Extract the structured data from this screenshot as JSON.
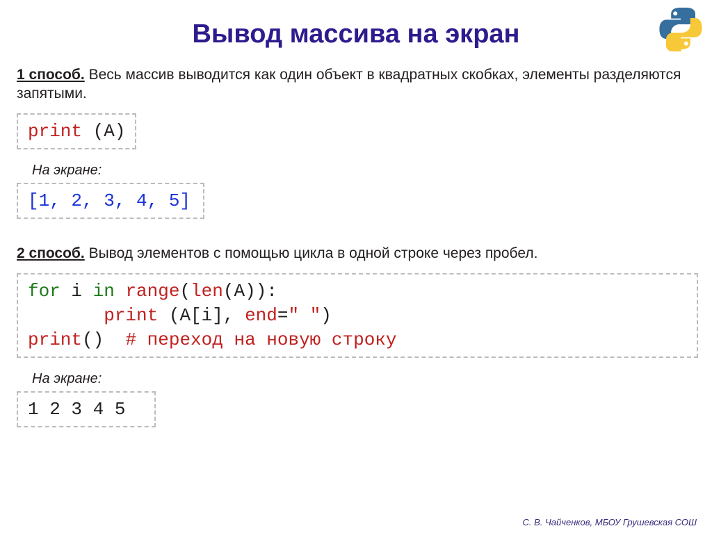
{
  "title": "Вывод массива на экран",
  "method1": {
    "heading": "1 способ.",
    "text": " Весь массив выводится как один объект в квадратных скобках, элементы разделяются запятыми."
  },
  "code1": {
    "print": "print",
    "arg": " (A)"
  },
  "label_screen": "На экране:",
  "output1": "[1, 2, 3, 4, 5]",
  "method2": {
    "heading": "2 способ.",
    "text": " Вывод элементов с помощью цикла в одной строке через пробел."
  },
  "code2": {
    "l1a": "for",
    "l1b": " i ",
    "l1c": "in",
    "l1d": " ",
    "l1e": "range",
    "l1f": "(",
    "l1g": "len",
    "l1h": "(A)):",
    "l2a": "       ",
    "l2b": "print",
    "l2c": " (A[i], ",
    "l2d": "end",
    "l2e": "=",
    "l2f": "\" \"",
    "l2g": ")",
    "l3a": "print",
    "l3b": "()  ",
    "l3c": "# переход на новую строку"
  },
  "output2": "1 2 3 4 5",
  "footer": "С. В. Чайченков, МБОУ Грушевская СОШ"
}
